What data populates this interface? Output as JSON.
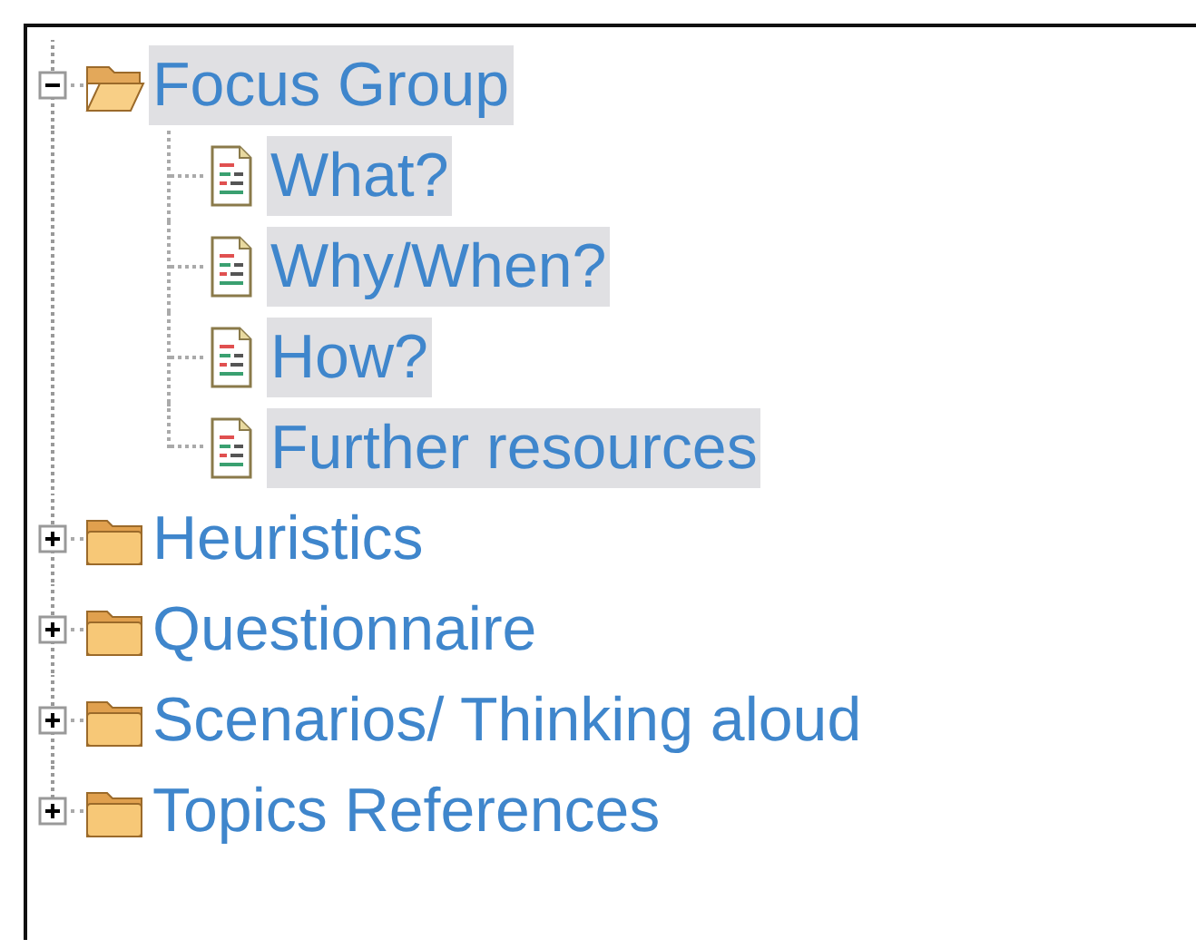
{
  "tree": [
    {
      "label": "Focus Group",
      "expanded": true,
      "selected": true,
      "children": [
        {
          "label": "What?",
          "selected": true
        },
        {
          "label": "Why/When?",
          "selected": true
        },
        {
          "label": "How?",
          "selected": true
        },
        {
          "label": "Further resources",
          "selected": true
        }
      ]
    },
    {
      "label": "Heuristics",
      "expanded": false,
      "selected": false
    },
    {
      "label": "Questionnaire",
      "expanded": false,
      "selected": false
    },
    {
      "label": "Scenarios/ Thinking aloud",
      "expanded": false,
      "selected": false
    },
    {
      "label": "Topics References",
      "expanded": false,
      "selected": false
    }
  ]
}
